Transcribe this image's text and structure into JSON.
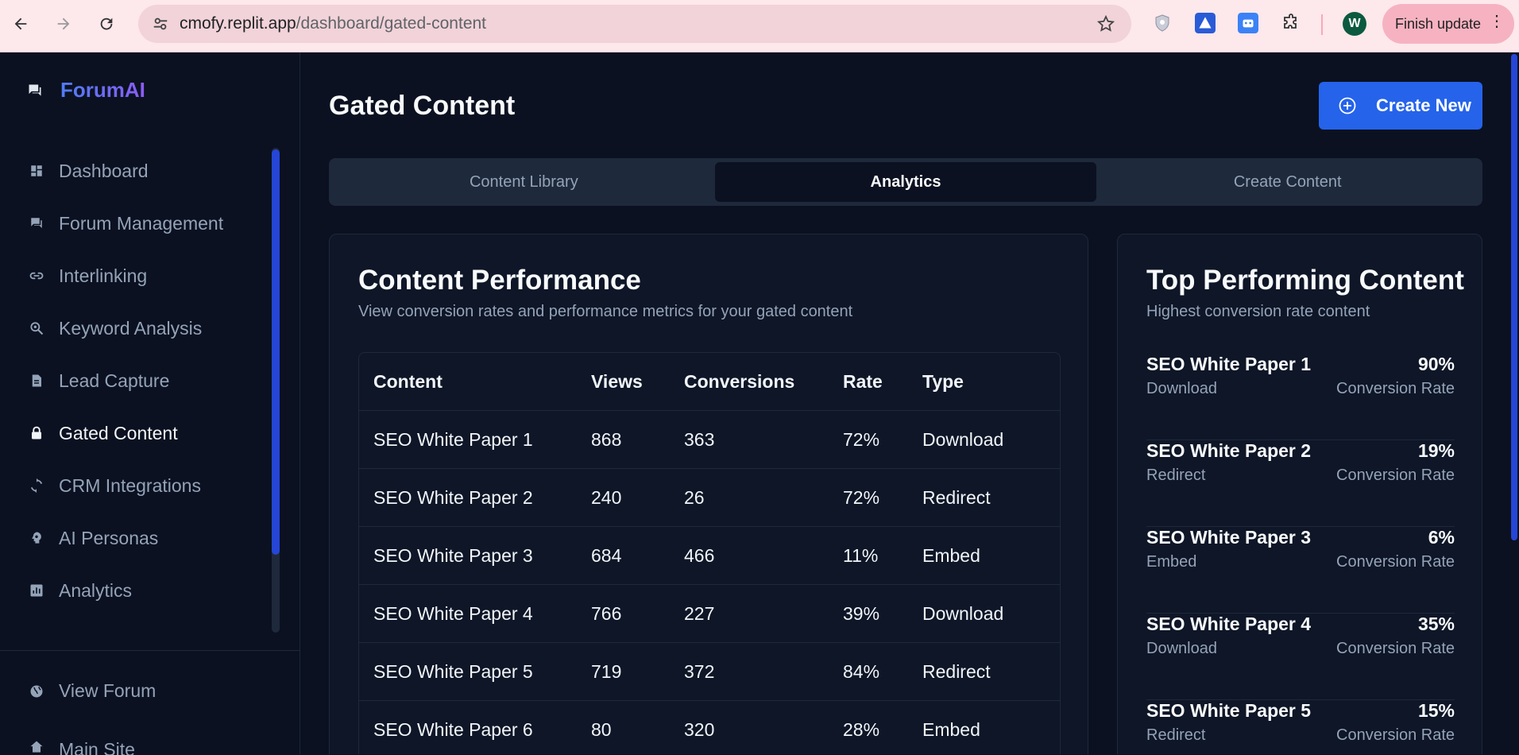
{
  "browser": {
    "url_host": "cmofy.replit.app",
    "url_path": "/dashboard/gated-content",
    "avatar_letter": "W",
    "finish_update": "Finish update"
  },
  "sidebar": {
    "brand": "ForumAI",
    "items": [
      {
        "label": "Dashboard",
        "icon": "dashboard-icon"
      },
      {
        "label": "Forum Management",
        "icon": "forum-icon"
      },
      {
        "label": "Interlinking",
        "icon": "link-icon"
      },
      {
        "label": "Keyword Analysis",
        "icon": "keyword-search-icon"
      },
      {
        "label": "Lead Capture",
        "icon": "document-icon"
      },
      {
        "label": "Gated Content",
        "icon": "lock-icon",
        "active": true
      },
      {
        "label": "CRM Integrations",
        "icon": "sync-icon"
      },
      {
        "label": "AI Personas",
        "icon": "persona-icon"
      },
      {
        "label": "Analytics",
        "icon": "analytics-icon"
      }
    ],
    "footer": {
      "view_forum": "View Forum",
      "main_site": "Main Site"
    }
  },
  "main": {
    "title": "Gated Content",
    "create_button": "Create New",
    "tabs": [
      "Content Library",
      "Analytics",
      "Create Content"
    ],
    "active_tab": "Analytics",
    "performance": {
      "title": "Content Performance",
      "subtitle": "View conversion rates and performance metrics for your gated content",
      "columns": [
        "Content",
        "Views",
        "Conversions",
        "Rate",
        "Type"
      ],
      "rows": [
        [
          "SEO White Paper 1",
          "868",
          "363",
          "72%",
          "Download"
        ],
        [
          "SEO White Paper 2",
          "240",
          "26",
          "72%",
          "Redirect"
        ],
        [
          "SEO White Paper 3",
          "684",
          "466",
          "11%",
          "Embed"
        ],
        [
          "SEO White Paper 4",
          "766",
          "227",
          "39%",
          "Download"
        ],
        [
          "SEO White Paper 5",
          "719",
          "372",
          "84%",
          "Redirect"
        ],
        [
          "SEO White Paper 6",
          "80",
          "320",
          "28%",
          "Embed"
        ]
      ]
    },
    "top_performing": {
      "title": "Top Performing Content",
      "subtitle": "Highest conversion rate content",
      "items": [
        {
          "name": "SEO White Paper 1",
          "rate": "90%",
          "type": "Download",
          "label": "Conversion Rate"
        },
        {
          "name": "SEO White Paper 2",
          "rate": "19%",
          "type": "Redirect",
          "label": "Conversion Rate"
        },
        {
          "name": "SEO White Paper 3",
          "rate": "6%",
          "type": "Embed",
          "label": "Conversion Rate"
        },
        {
          "name": "SEO White Paper 4",
          "rate": "35%",
          "type": "Download",
          "label": "Conversion Rate"
        },
        {
          "name": "SEO White Paper 5",
          "rate": "15%",
          "type": "Redirect",
          "label": "Conversion Rate"
        }
      ]
    }
  },
  "colors": {
    "background": "#0b1120",
    "accent": "#2563eb",
    "chrome": "#fde8ec"
  }
}
